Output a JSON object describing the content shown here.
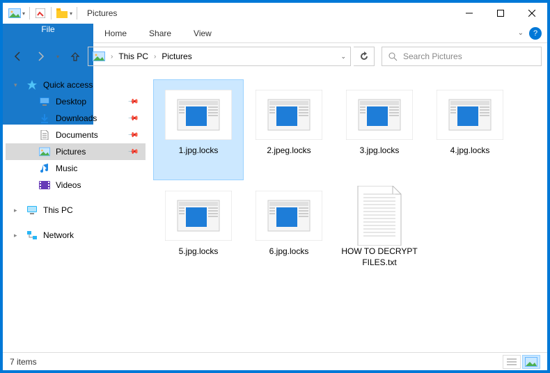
{
  "titlebar": {
    "title": "Pictures"
  },
  "ribbon": {
    "file": "File",
    "tabs": [
      "Home",
      "Share",
      "View"
    ]
  },
  "breadcrumb": {
    "items": [
      "This PC",
      "Pictures"
    ]
  },
  "search": {
    "placeholder": "Search Pictures"
  },
  "sidebar": {
    "quick_access": "Quick access",
    "items": [
      {
        "label": "Desktop",
        "icon": "desktop"
      },
      {
        "label": "Downloads",
        "icon": "downloads"
      },
      {
        "label": "Documents",
        "icon": "documents"
      },
      {
        "label": "Pictures",
        "icon": "pictures",
        "selected": true
      },
      {
        "label": "Music",
        "icon": "music"
      },
      {
        "label": "Videos",
        "icon": "videos"
      }
    ],
    "this_pc": "This PC",
    "network": "Network"
  },
  "files": [
    {
      "name": "1.jpg.locks",
      "type": "locked",
      "selected": true
    },
    {
      "name": "2.jpeg.locks",
      "type": "locked"
    },
    {
      "name": "3.jpg.locks",
      "type": "locked"
    },
    {
      "name": "4.jpg.locks",
      "type": "locked"
    },
    {
      "name": "5.jpg.locks",
      "type": "locked"
    },
    {
      "name": "6.jpg.locks",
      "type": "locked"
    },
    {
      "name": "HOW TO DECRYPT FILES.txt",
      "type": "txt"
    }
  ],
  "status": {
    "count": "7 items"
  }
}
